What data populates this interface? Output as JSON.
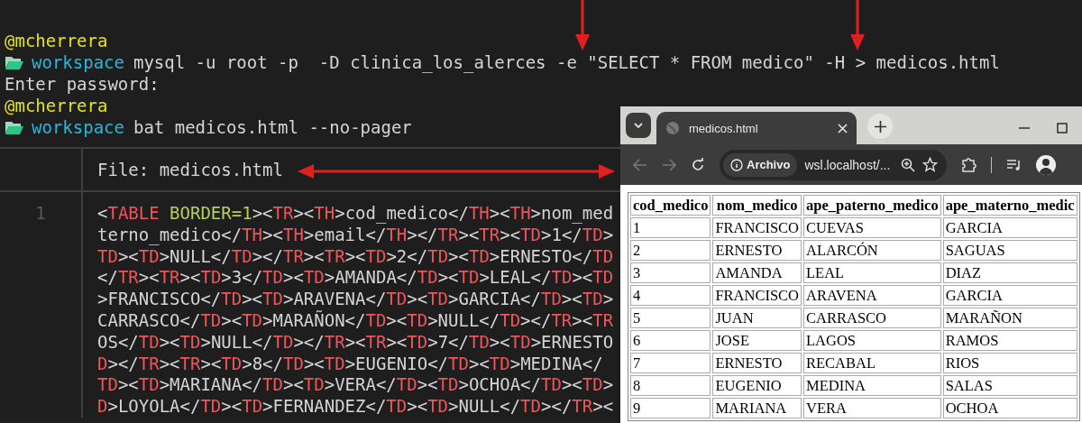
{
  "terminal": {
    "lines": [
      {
        "kind": "user",
        "text": "@mcherrera"
      },
      {
        "kind": "command",
        "dir": "workspace",
        "text": "mysql -u root -p  -D clinica_los_alerces -e \"SELECT * FROM medico\" -H > medicos.html"
      },
      {
        "kind": "output",
        "text": "Enter password:"
      },
      {
        "kind": "user",
        "text": "@mcherrera"
      },
      {
        "kind": "command",
        "dir": "workspace",
        "text": "bat medicos.html --no-pager"
      }
    ]
  },
  "bat": {
    "file_label": "File: medicos.html",
    "line_number": "1",
    "code_lines": [
      {
        "text": "<TABLE BORDER=1><TR><TH>cod_medico</TH><TH>nom_med"
      },
      {
        "text": "terno_medico</TH><TH>email</TH></TR><TR><TD>1</TD>",
        "starts_in_tag": false
      },
      {
        "text": "TD><TD>NULL</TD></TR><TR><TD>2</TD><TD>ERNESTO</TD",
        "starts_in_tag": true
      },
      {
        "text": "</TR><TR><TD>3</TD><TD>AMANDA</TD><TD>LEAL</TD><TD"
      },
      {
        "text": ">FRANCISCO</TD><TD>ARAVENA</TD><TD>GARCIA</TD><TD>"
      },
      {
        "text": "CARRASCO</TD><TD>MARAÑON</TD><TD>NULL</TD></TR><TR",
        "starts_in_tag": false
      },
      {
        "text": "OS</TD><TD>NULL</TD></TR><TR><TD>7</TD><TD>ERNESTO",
        "starts_in_tag": false
      },
      {
        "text": "D></TR><TR><TD>8</TD><TD>EUGENIO</TD><TD>MEDINA</",
        "starts_in_tag": true
      },
      {
        "text": "TD><TD>MARIANA</TD><TD>VERA</TD><TD>OCHOA</TD><TD>",
        "starts_in_tag": true
      },
      {
        "text": "D>LOYOLA</TD><TD>FERNANDEZ</TD><TD>NULL</TD></TR><",
        "starts_in_tag": true
      }
    ]
  },
  "browser": {
    "tab": {
      "title": "medicos.html"
    },
    "site_chip": "Archivo",
    "url": "wsl.localhost/...",
    "table": {
      "columns": [
        "cod_medico",
        "nom_medico",
        "ape_paterno_medico",
        "ape_materno_medic"
      ],
      "rows": [
        [
          "1",
          "FRANCISCO",
          "CUEVAS",
          "GARCIA"
        ],
        [
          "2",
          "ERNESTO",
          "ALARCÓN",
          "SAGUAS"
        ],
        [
          "3",
          "AMANDA",
          "LEAL",
          "DIAZ"
        ],
        [
          "4",
          "FRANCISCO",
          "ARAVENA",
          "GARCIA"
        ],
        [
          "5",
          "JUAN",
          "CARRASCO",
          "MARAÑON"
        ],
        [
          "6",
          "JOSE",
          "LAGOS",
          "RAMOS"
        ],
        [
          "7",
          "ERNESTO",
          "RECABAL",
          "RIOS"
        ],
        [
          "8",
          "EUGENIO",
          "MEDINA",
          "SALAS"
        ],
        [
          "9",
          "MARIANA",
          "VERA",
          "OCHOA"
        ]
      ]
    }
  }
}
